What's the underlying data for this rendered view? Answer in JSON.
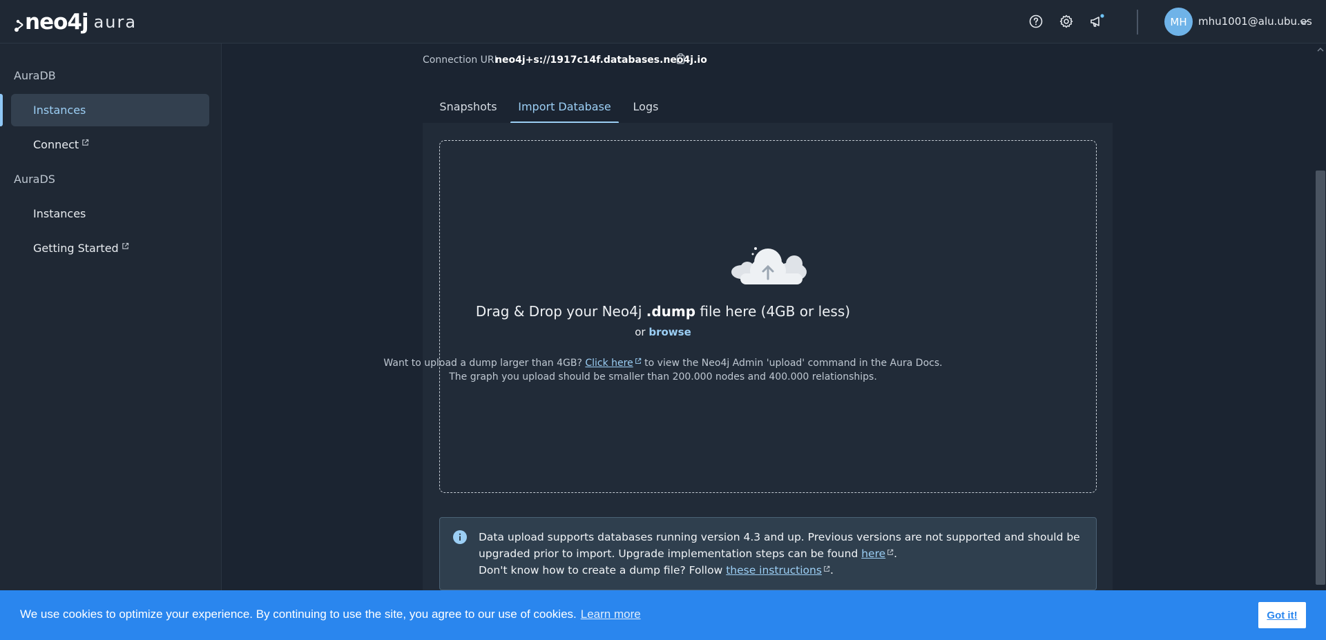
{
  "header": {
    "logo_text": "neo4j",
    "logo_suffix": "aura",
    "icons": [
      "help-icon",
      "settings-icon",
      "announcements-icon"
    ],
    "user_initials": "MH",
    "user_email": "mhu1001@alu.ubu.es"
  },
  "sidebar": {
    "sections": [
      {
        "label": "AuraDB",
        "items": [
          {
            "label": "Instances",
            "active": true
          },
          {
            "label": "Connect",
            "external": true
          }
        ]
      },
      {
        "label": "AuraDS",
        "items": [
          {
            "label": "Instances"
          },
          {
            "label": "Getting Started",
            "external": true
          }
        ]
      }
    ]
  },
  "main": {
    "connection_label": "Connection URI",
    "connection_uri": "neo4j+s://1917c14f.databases.neo4j.io",
    "tabs": [
      {
        "label": "Snapshots"
      },
      {
        "label": "Import Database",
        "active": true
      },
      {
        "label": "Logs"
      }
    ],
    "dropzone": {
      "title_prefix": "Drag & Drop your Neo4j ",
      "title_bold": ".dump",
      "title_suffix": " file here (4GB or less)",
      "or_text": "or ",
      "browse_label": "browse",
      "help_prefix": "Want to upload a dump larger than 4GB? ",
      "help_link": "Click here",
      "help_suffix": " to view the Neo4j Admin 'upload' command in the Aura Docs.",
      "help_line2": "The graph you upload should be smaller than 200.000 nodes and 400.000 relationships."
    },
    "info": {
      "line1": "Data upload supports databases running version 4.3 and up. Previous versions are not supported and should be upgraded prior to import. Upgrade implementation steps can be found ",
      "line1_link": "here",
      "line2_prefix": "Don't know how to create a dump file? Follow ",
      "line2_link": "these instructions"
    }
  },
  "cookie": {
    "text": "We use cookies to optimize your experience. By continuing to use the site, you agree to our use of cookies.",
    "learn_more": "Learn more",
    "button": "Got it!"
  },
  "colors": {
    "accent": "#9ccff5",
    "background": "#1b2431",
    "cookie_bar": "#2a86ee"
  }
}
